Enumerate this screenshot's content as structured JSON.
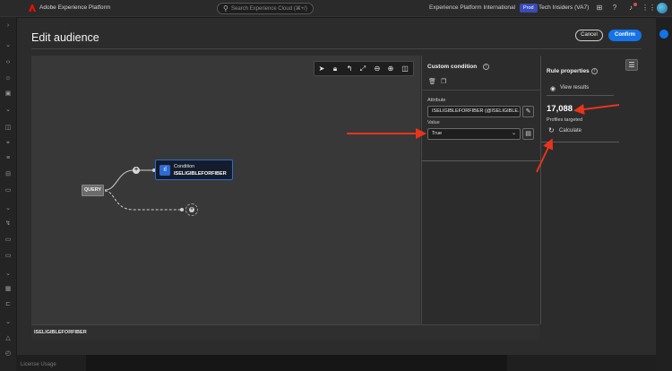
{
  "app": {
    "brand": "Adobe Experience Platform",
    "search_placeholder": "Search Experience Cloud (⌘+/)",
    "environment": "Experience Platform International",
    "env_badge": "Prod",
    "org": "Tech Insiders (VA7)",
    "icons": [
      "grid-icon",
      "help-icon",
      "bell-icon",
      "apps-icon",
      "avatar"
    ]
  },
  "sidebar": {
    "icons": [
      "chevron-right-icon",
      "chevron-down-icon",
      "code-icon",
      "user-icon",
      "dashboard-icon",
      "chevron-down-icon",
      "segment-icon",
      "location-icon",
      "database-icon",
      "schema-icon",
      "message-icon",
      "chevron-down-icon",
      "connection-icon",
      "chat-icon",
      "chat-icon",
      "chevron-down-icon",
      "cube-icon",
      "plug-icon",
      "chevron-down-icon",
      "warning-icon",
      "history-icon"
    ]
  },
  "bottom": {
    "license": "License Usage"
  },
  "modal": {
    "title": "Edit audience",
    "cancel_label": "Cancel",
    "confirm_label": "Confirm",
    "footer_label": "ISELIGIBLEFORFIBER"
  },
  "canvas": {
    "query_label": "QUERY",
    "condition_title": "Condition",
    "condition_name": "ISELIGIBLEFORFIBER",
    "toolbar": [
      "pointer-icon",
      "lock-icon",
      "undo-icon",
      "expand-icon",
      "zoom-out-icon",
      "zoom-in-icon",
      "columns-icon"
    ]
  },
  "custom_condition": {
    "header": "Custom condition",
    "attribute_label": "Attribute",
    "attribute_value": "ISELIGIBLEFORFIBER (@ISELIGIBLE...",
    "value_label": "Value",
    "value_selected": "True"
  },
  "rule_properties": {
    "header": "Rule properties",
    "view_results": "View results",
    "profiles_count": "17,088",
    "profiles_label": "Profiles targeted",
    "calculate": "Calculate"
  },
  "colors": {
    "accent": "#1473e6",
    "annotation_arrow": "#e8341c",
    "node_border": "#2d6bd4"
  }
}
